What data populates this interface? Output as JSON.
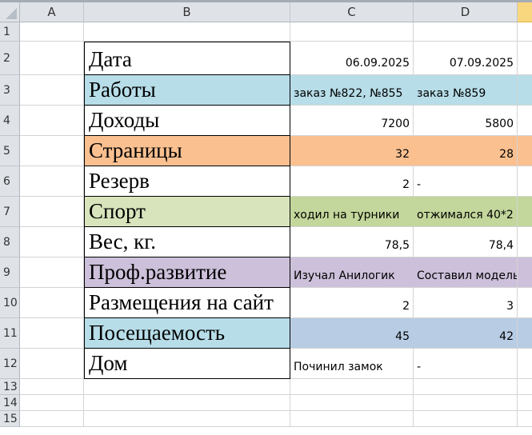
{
  "columns": [
    "A",
    "B",
    "C",
    "D"
  ],
  "row_numbers": [
    "1",
    "2",
    "3",
    "4",
    "5",
    "6",
    "7",
    "8",
    "9",
    "10",
    "11",
    "12",
    "13",
    "14",
    "15"
  ],
  "rows": [
    {
      "label": "Дата",
      "c": "06.09.2025",
      "d": "07.09.2025"
    },
    {
      "label": "Работы",
      "c": "заказ №822, №855",
      "d": "заказ №859"
    },
    {
      "label": "Доходы",
      "c": "7200",
      "d": "5800"
    },
    {
      "label": "Страницы",
      "c": "32",
      "d": "28"
    },
    {
      "label": "Резерв",
      "c": "2",
      "d": "-"
    },
    {
      "label": "Спорт",
      "c": "ходил на турники",
      "d": "отжимался 40*2"
    },
    {
      "label": "Вес, кг.",
      "c": "78,5",
      "d": "78,4"
    },
    {
      "label": "Проф.развитие",
      "c": "Изучал Анилогик",
      "d": "Составил модель А"
    },
    {
      "label": "Размещения на сайт",
      "c": "2",
      "d": "3"
    },
    {
      "label": "Посещаемость",
      "c": "45",
      "d": "42"
    },
    {
      "label": "Дом",
      "c": "Починил замок",
      "d": "-"
    }
  ],
  "colors": {
    "blue": "#b7dde8",
    "orange": "#fac090",
    "green_light": "#d8e4bc",
    "green": "#c3d69b",
    "lilac": "#ccc0da",
    "steel": "#b8cce4"
  }
}
